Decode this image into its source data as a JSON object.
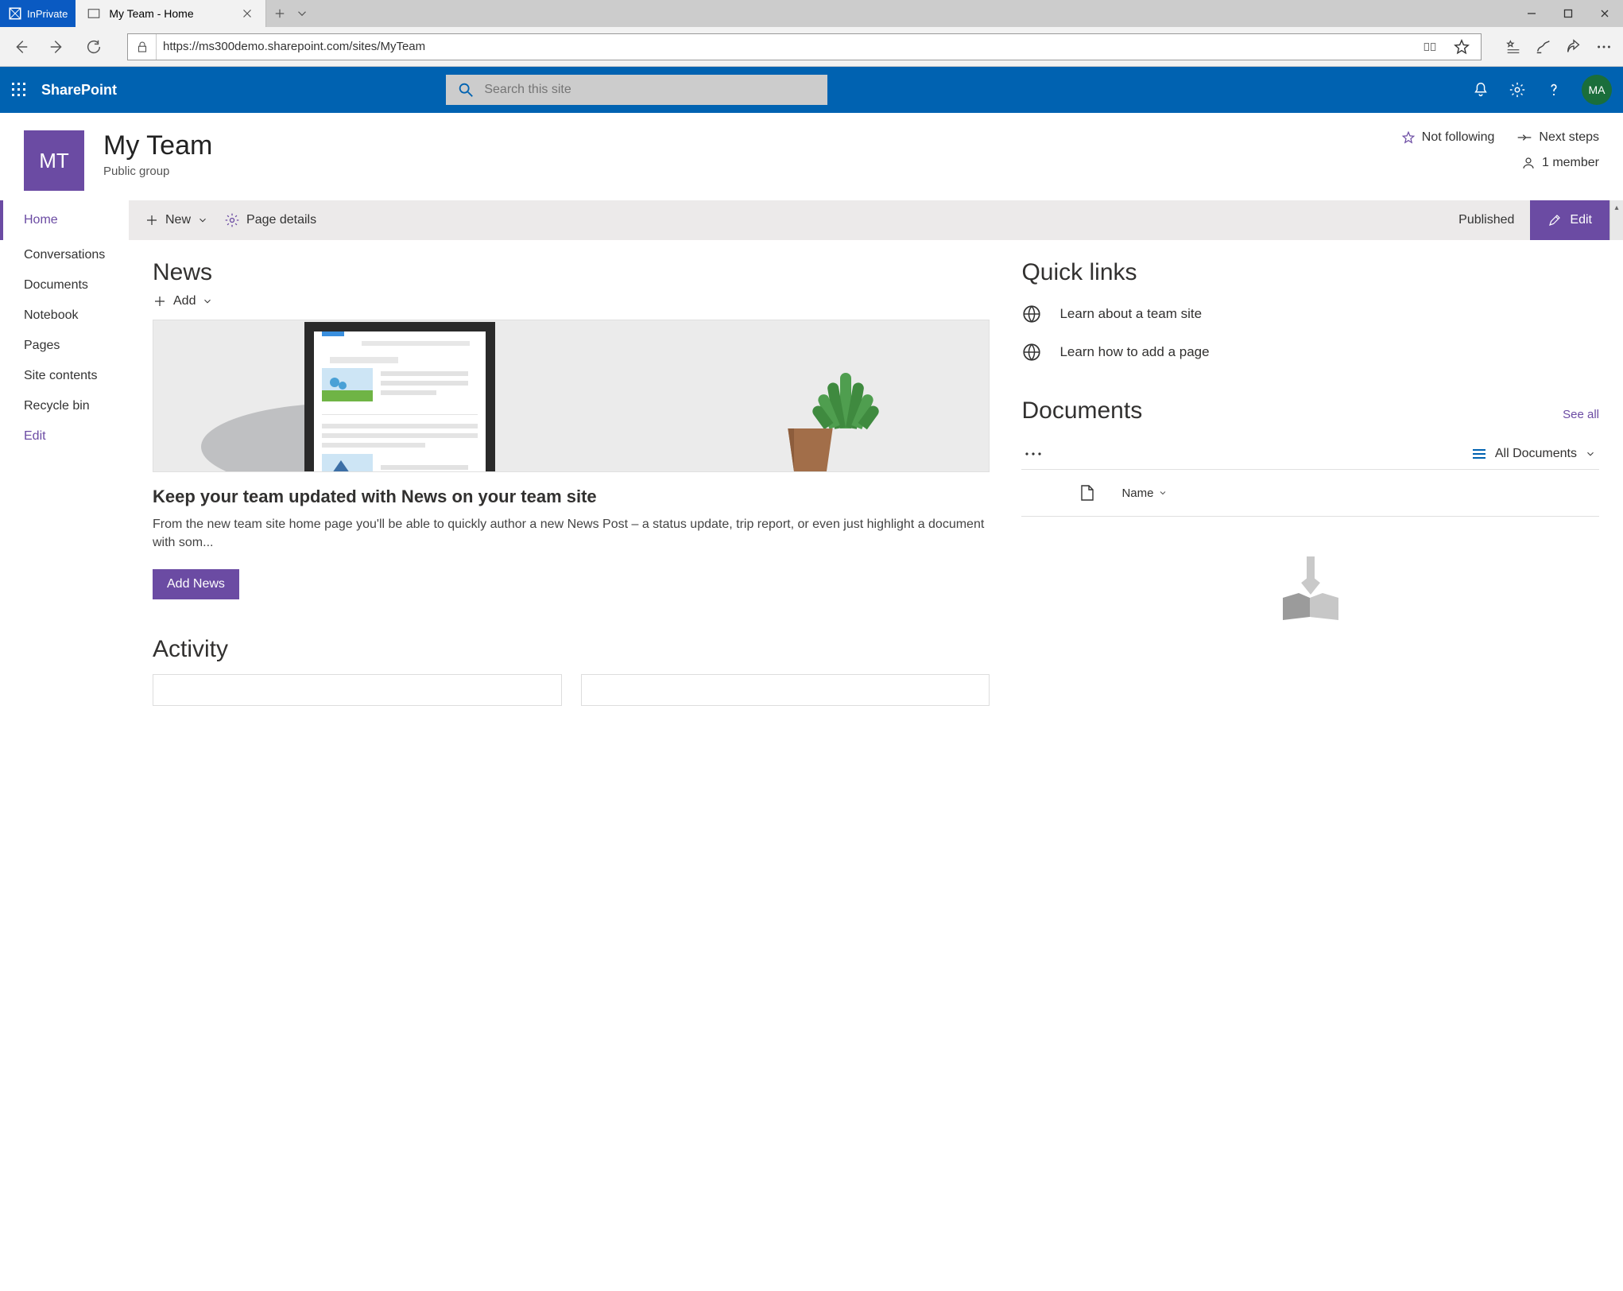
{
  "window": {
    "inprivate": "InPrivate",
    "tab_title": "My Team - Home",
    "url": "https://ms300demo.sharepoint.com/sites/MyTeam"
  },
  "suite": {
    "app_name": "SharePoint",
    "search_placeholder": "Search this site",
    "avatar_initials": "MA"
  },
  "site": {
    "logo_initials": "MT",
    "title": "My Team",
    "subtitle": "Public group",
    "not_following": "Not following",
    "next_steps": "Next steps",
    "members": "1 member"
  },
  "cmdbar": {
    "new": "New",
    "page_details": "Page details",
    "published": "Published",
    "edit": "Edit"
  },
  "leftnav": {
    "items": [
      "Home",
      "Conversations",
      "Documents",
      "Notebook",
      "Pages",
      "Site contents",
      "Recycle bin"
    ],
    "edit": "Edit"
  },
  "news": {
    "heading": "News",
    "add": "Add",
    "item_title": "Keep your team updated with News on your team site",
    "item_body": "From the new team site home page you'll be able to quickly author a new News Post – a status update, trip report, or even just highlight a document with som...",
    "add_news_btn": "Add News"
  },
  "activity": {
    "heading": "Activity"
  },
  "quicklinks": {
    "heading": "Quick links",
    "items": [
      "Learn about a team site",
      "Learn how to add a page"
    ]
  },
  "documents": {
    "heading": "Documents",
    "see_all": "See all",
    "view": "All Documents",
    "col_name": "Name"
  }
}
